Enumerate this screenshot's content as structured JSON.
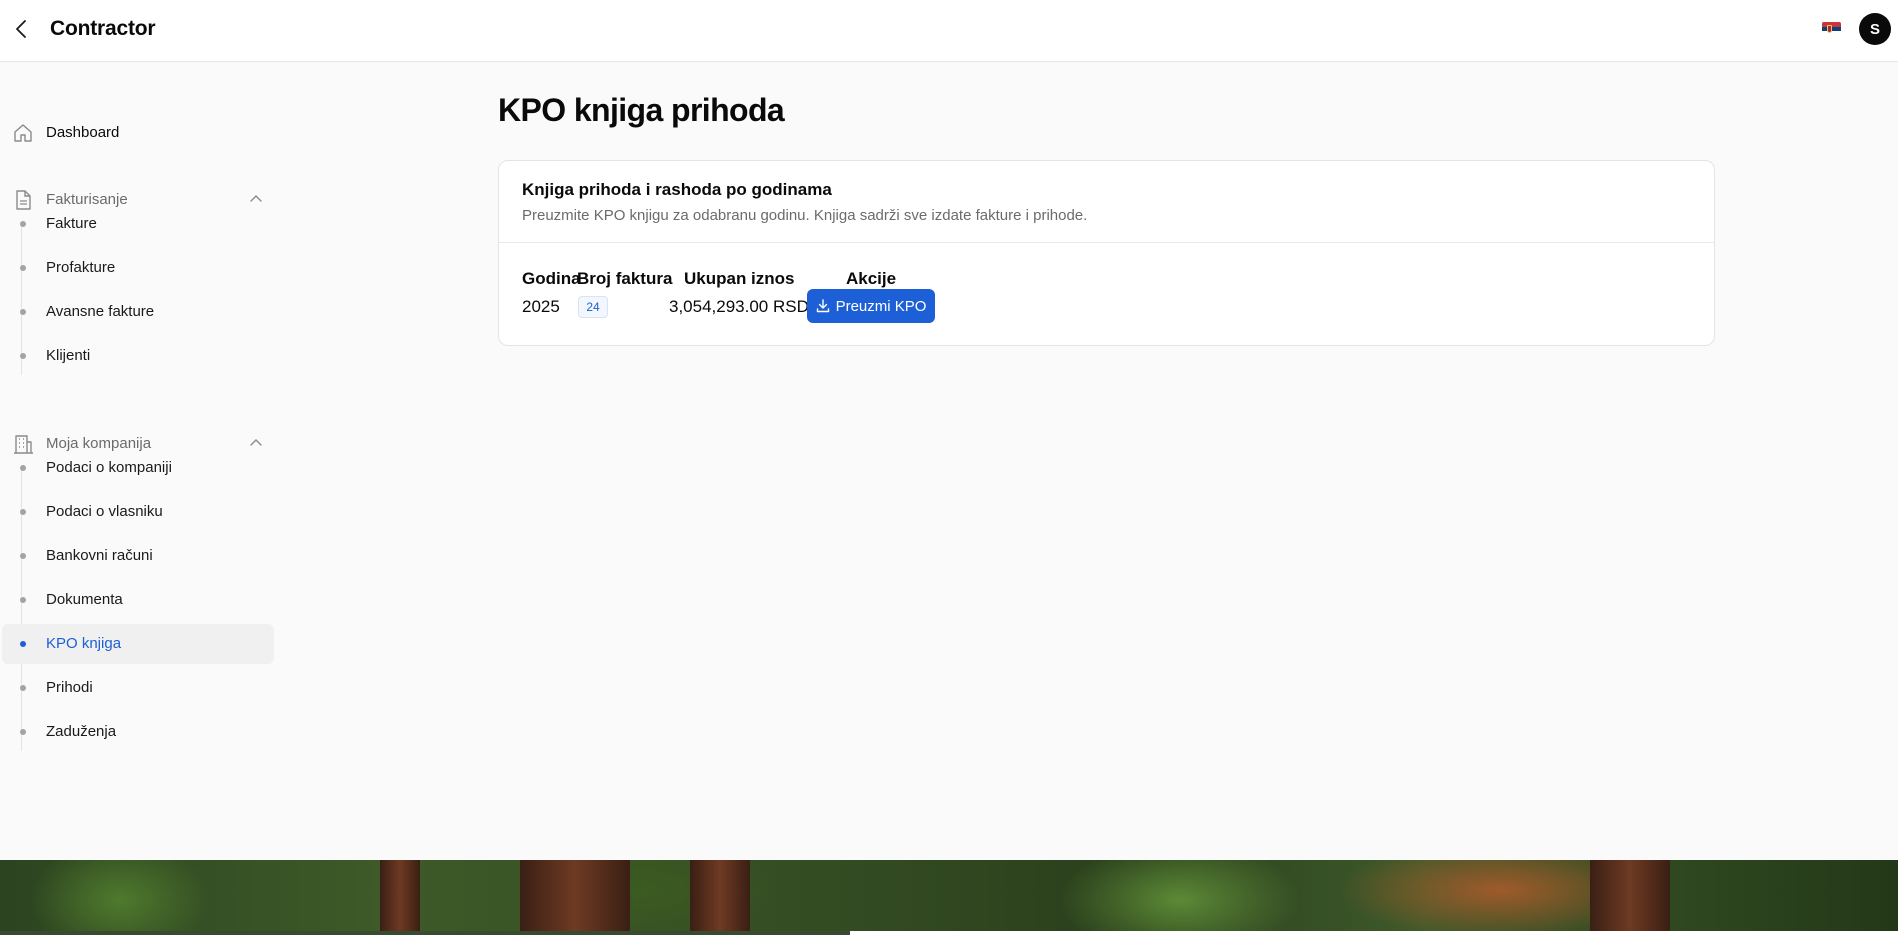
{
  "header": {
    "title": "Contractor",
    "avatar_initial": "S",
    "language_flag_icon": "serbia-flag-icon"
  },
  "sidebar": {
    "dashboard": {
      "label": "Dashboard",
      "icon": "home-icon"
    },
    "invoicing": {
      "label": "Fakturisanje",
      "icon": "document-icon",
      "items": [
        {
          "label": "Fakture"
        },
        {
          "label": "Profakture"
        },
        {
          "label": "Avansne fakture"
        },
        {
          "label": "Klijenti"
        }
      ]
    },
    "company": {
      "label": "Moja kompanija",
      "icon": "building-icon",
      "items": [
        {
          "label": "Podaci o kompaniji"
        },
        {
          "label": "Podaci o vlasniku"
        },
        {
          "label": "Bankovni računi"
        },
        {
          "label": "Dokumenta"
        },
        {
          "label": "KPO knjiga",
          "active": true
        },
        {
          "label": "Prihodi"
        },
        {
          "label": "Zaduženja"
        }
      ]
    }
  },
  "main": {
    "page_title": "KPO knjiga prihoda",
    "card": {
      "title": "Knjiga prihoda i rashoda po godinama",
      "description": "Preuzmite KPO knjigu za odabranu godinu. Knjiga sadrži sve izdate fakture i prihode.",
      "columns": [
        "Godina",
        "Broj faktura",
        "Ukupan iznos",
        "Akcije"
      ],
      "rows": [
        {
          "year": "2025",
          "invoice_count": "24",
          "total": "3,054,293.00 RSD",
          "action_label": "Preuzmi KPO"
        }
      ]
    }
  },
  "colors": {
    "accent": "#1d5fd6",
    "text": "#0a0a0a",
    "muted": "#6b6b6b",
    "background": "#fafafa"
  }
}
